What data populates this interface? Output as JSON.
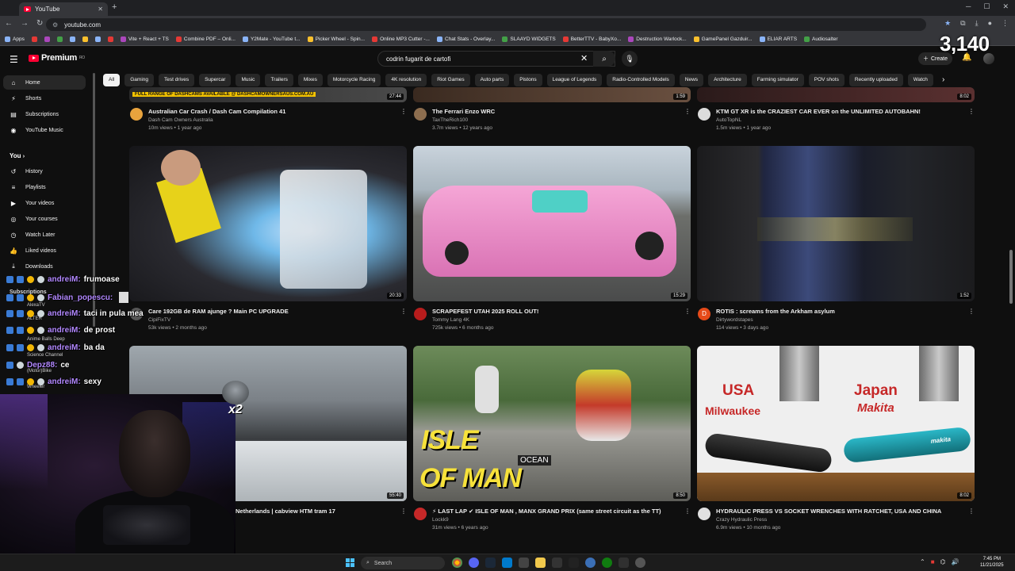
{
  "browser": {
    "tab_title": "YouTube",
    "new_tab": "+",
    "url": "youtube.com",
    "bookmarks": [
      "Apps",
      "Vite + React + TS",
      "Combine PDF – Onli...",
      "Y2Mate - YouTube t...",
      "Picker Wheel - Spin...",
      "Online MP3 Cutter -...",
      "Chat Stats - Overlay...",
      "SLAAYD WIDGETS",
      "BetterTTV - BabyXo...",
      "Destruction Warlock...",
      "GamePanel Gazduir...",
      "ELIAR ARTS",
      "Audiosalter"
    ]
  },
  "youtube": {
    "logo_text": "Premium",
    "logo_region": "RO",
    "search_value": "codrin fugarit de cartofi",
    "create_label": "Create"
  },
  "stream_overlay": {
    "viewer_count": "3,140",
    "emote_multiplier": "x2"
  },
  "chips": [
    "All",
    "Gaming",
    "Test drives",
    "Supercar",
    "Music",
    "Trailers",
    "Mixes",
    "Motorcycle Racing",
    "4K resolution",
    "Riot Games",
    "Auto parts",
    "Pistons",
    "League of Legends",
    "Radio-Controlled Models",
    "News",
    "Architecture",
    "Farming simulator",
    "POV shots",
    "Recently uploaded",
    "Watch"
  ],
  "sidebar": {
    "home": "Home",
    "shorts": "Shorts",
    "subscriptions": "Subscriptions",
    "music": "YouTube Music",
    "you": "You",
    "history": "History",
    "playlists": "Playlists",
    "your_videos": "Your videos",
    "your_courses": "Your courses",
    "watch_later": "Watch Later",
    "liked": "Liked videos",
    "downloads": "Downloads",
    "subs_heading": "Subscriptions",
    "subs": [
      "AlexaTV",
      "ALTER",
      "Anime Balls Deep",
      "Science Channel",
      "(Motor)Bike",
      "Wheeler"
    ]
  },
  "videos": [
    {
      "title": "Australian Car Crash / Dash Cam Compilation 41",
      "channel": "Dash Cam Owners Australia",
      "meta": "10m views • 1 year ago",
      "duration": "27:44",
      "banner": "FULL RANGE OF DASHCAMS AVAILABLE @ DASHCAMOWNERSAUS.COM.AU"
    },
    {
      "title": "The Ferrari Enzo WRC",
      "channel": "TaxTheRich100",
      "meta": "3.7m views • 12 years ago",
      "duration": "1:59"
    },
    {
      "title": "KTM GT XR is the CRAZIEST CAR EVER on the UNLIMITED AUTOBAHN!",
      "channel": "AutoTopNL",
      "meta": "1.5m views • 1 year ago",
      "duration": "8:02"
    },
    {
      "title": "Care 192GB de RAM ajunge ? Main PC UPGRADE",
      "channel": "CipiFixTV",
      "meta": "53k views • 2 months ago",
      "duration": "20:33"
    },
    {
      "title": "SCRAPEFEST UTAH 2025 ROLL OUT!",
      "channel": "Tommy Lang 4K",
      "meta": "725k views • 6 months ago",
      "duration": "15:29"
    },
    {
      "title": "ROTIS : screams from the Arkham asylum",
      "channel": "Dirtywordstapes",
      "meta": "114 views • 3 days ago",
      "duration": "1:52",
      "avatar_letter": "D"
    },
    {
      "title": "Netherlands | cabview HTM tram 17",
      "duration": "55:40"
    },
    {
      "title": "⚡ LAST LAP ✔ ISLE OF MAN , MANX GRAND PRIX (same street circuit as the TT)",
      "channel": "Lockk9",
      "meta": "31m views • 6 years ago",
      "duration": "8:50",
      "overlay_text_1": "ISLE",
      "overlay_text_2": "OF MAN",
      "sign_text": "OCEAN"
    },
    {
      "title": "HYDRAULIC PRESS VS SOCKET WRENCHES WITH RATCHET, USA AND CHINA",
      "channel": "Crazy Hydraulic Press",
      "meta": "6.9m views • 10 months ago",
      "duration": "8:02",
      "overlay_usa": "USA",
      "overlay_milwaukee": "Milwaukee",
      "overlay_japan": "Japan",
      "overlay_makita": "Makita",
      "tool_label": "makita"
    }
  ],
  "chat": [
    {
      "user": "andreiM:",
      "msg": "frumoase"
    },
    {
      "user": "Fabian_popescu:",
      "msg": ""
    },
    {
      "user": "andreiM:",
      "msg": "taci in pula mea"
    },
    {
      "user": "andreiM:",
      "msg": "de prost"
    },
    {
      "user": "andreiM:",
      "msg": "ba da"
    },
    {
      "user": "Depz88:",
      "msg": "ce"
    },
    {
      "user": "andreiM:",
      "msg": "sexy"
    }
  ],
  "taskbar": {
    "search": "Search",
    "time": "7:45 PM",
    "date": "11/21/2025"
  }
}
